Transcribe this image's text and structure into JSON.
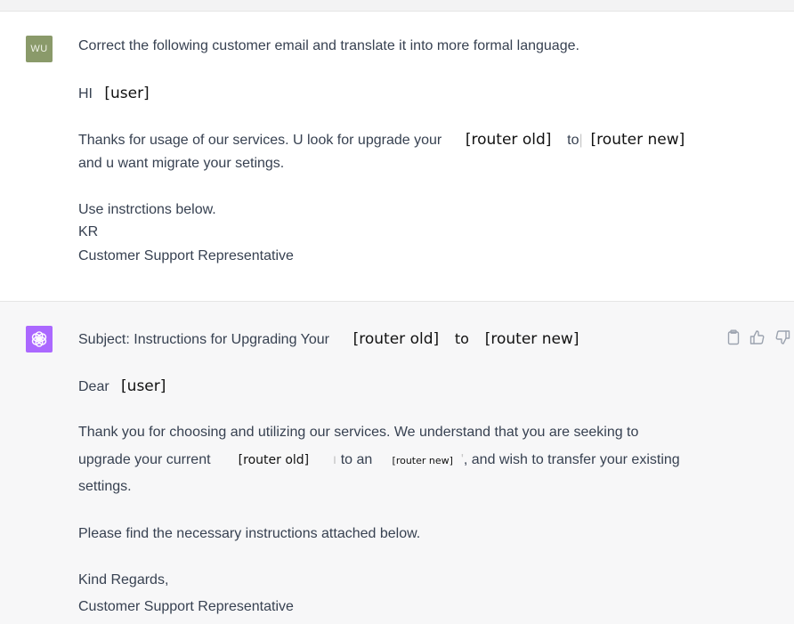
{
  "user_message": {
    "avatar_initials": "WU",
    "prompt": "Correct the following customer email and translate it into more formal language.",
    "greeting": "HI",
    "greeting_user_placeholder": "[user]",
    "line1_a": "Thanks for usage of our services. U look for upgrade your",
    "line1_placeholder_old": "[router old]",
    "line1_to": "to",
    "line1_placeholder_new": "[router new]",
    "line2": "and u want migrate your  setings.",
    "line3": "Use instrctions below.",
    "line4": "KR",
    "line5": "Customer Support Representative"
  },
  "assistant_message": {
    "subject_prefix": "Subject: Instructions for Upgrading Your",
    "subject_placeholder_old": "[router old]",
    "subject_to": "to",
    "subject_placeholder_new": "[router new]",
    "dear": "Dear",
    "dear_user_placeholder": "[user]",
    "para1_line1": "Thank you for choosing and utilizing our services. We understand that you are seeking to",
    "para1_line2_a": "upgrade your current",
    "para1_line2_placeholder_old": "[router old]",
    "para1_line2_b": "to an",
    "para1_line2_placeholder_new": "[router new]",
    "para1_line2_c": ", and wish to transfer your existing",
    "para1_line3": "settings.",
    "para2": "Please find the necessary instructions attached below.",
    "closing": "Kind Regards,",
    "signature": "Customer Support Representative"
  },
  "actions": {
    "icons": [
      "clipboard-icon",
      "thumbs-up-icon",
      "thumbs-down-icon"
    ]
  },
  "colors": {
    "assistant_bg": "#f7f7f8",
    "user_avatar": "#8a9a6a",
    "assistant_avatar": "#ab68ff",
    "text": "#374151"
  }
}
